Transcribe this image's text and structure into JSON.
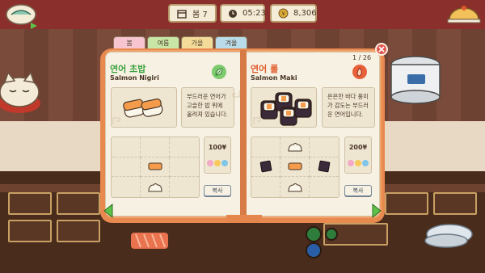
{
  "hud": {
    "day": "봄 7",
    "time": "05:23",
    "money": "8,306"
  },
  "season_tabs": [
    {
      "label": "봄",
      "color": "#f7c5cf",
      "active": true
    },
    {
      "label": "여름",
      "color": "#c8e6a5",
      "active": false
    },
    {
      "label": "가을",
      "color": "#f3dc9a",
      "active": false
    },
    {
      "label": "겨울",
      "color": "#b8dcea",
      "active": false
    }
  ],
  "book": {
    "page_indicator": "1 / 26",
    "recipes": [
      {
        "name_ko": "연어 초밥",
        "name_en": "Salmon Nigiri",
        "title_color": "#3aa23e",
        "badge_color": "#7dcb6e",
        "badge_icon": "leaf-icon",
        "description": "부드러운 연어가 고슬한 밥 위에 올려져 있습니다.",
        "price": "100¥",
        "copy_label": "복사",
        "ingredient_grid": [
          "",
          "",
          "",
          "",
          "salmon",
          "",
          "",
          "rice",
          ""
        ]
      },
      {
        "name_ko": "연어 롤",
        "name_en": "Salmon Maki",
        "title_color": "#e05a2b",
        "badge_color": "#e8603a",
        "badge_icon": "fire-icon",
        "description": "은은한 바다 풍미가 감도는 부드러운 연어입니다.",
        "price": "200¥",
        "copy_label": "복사",
        "ingredient_grid": [
          "",
          "rice",
          "",
          "nori",
          "salmon",
          "nori",
          "",
          "rice",
          ""
        ]
      }
    ]
  },
  "colors": {
    "book_orange": "#f0a26a",
    "page_cream": "#f7f1e3",
    "arrow_green": "#5cc24a"
  }
}
